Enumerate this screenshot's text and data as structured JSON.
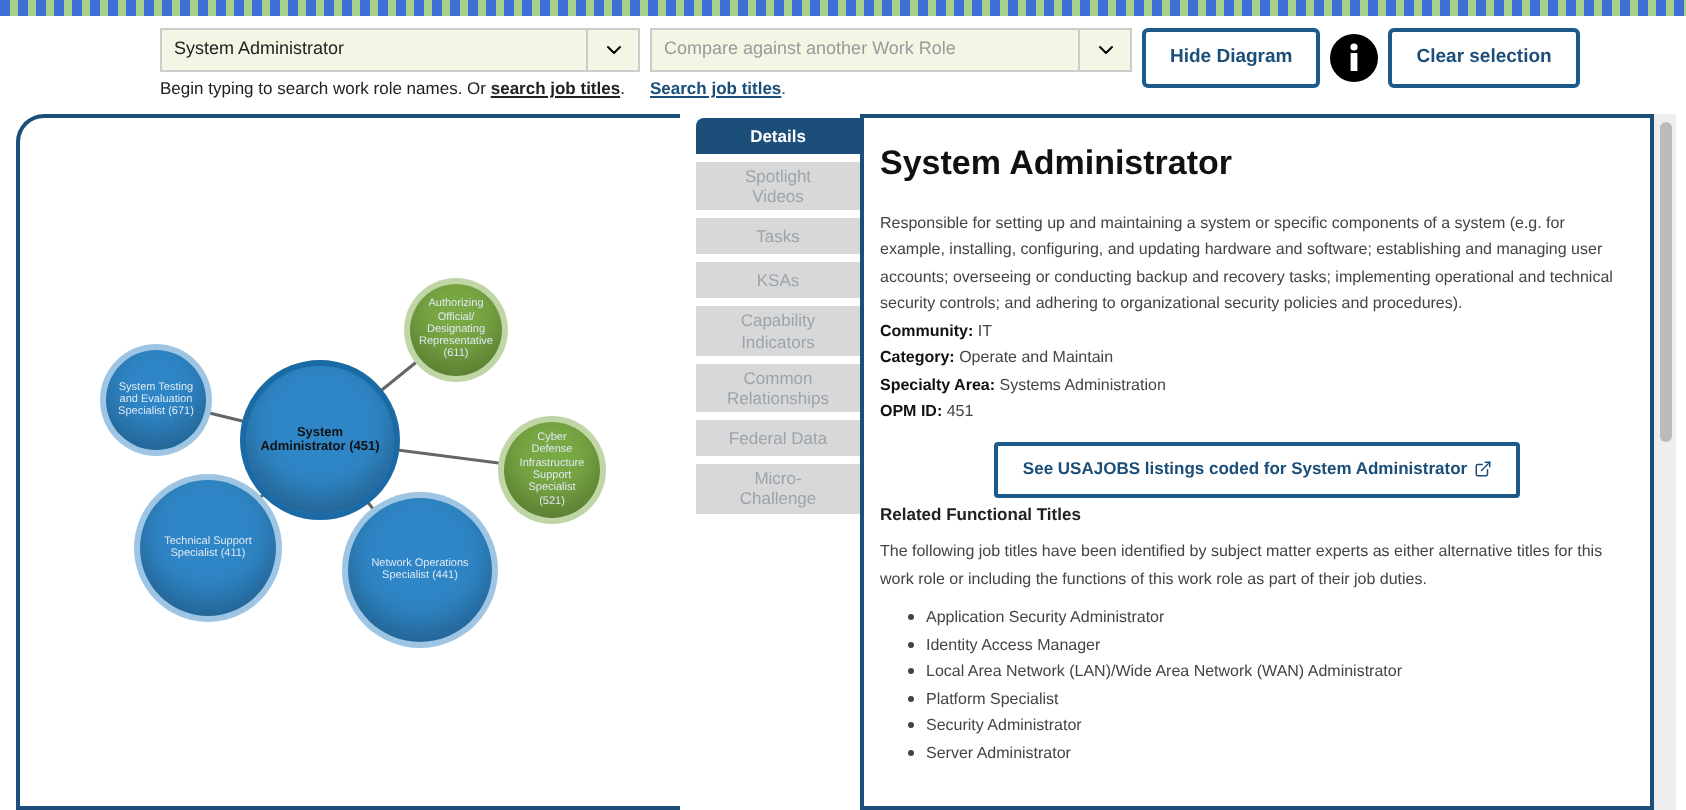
{
  "search": {
    "role_select": {
      "value": "System Administrator"
    },
    "compare_select": {
      "placeholder": "Compare against another Work Role"
    },
    "hint": {
      "text": "Begin typing to search work role names. Or ",
      "link": "search job titles",
      "end": "."
    },
    "compare_hint": {
      "link": "Search job titles",
      "end": "."
    },
    "buttons": [
      {
        "kind": "button",
        "label": "Hide Diagram"
      },
      {
        "kind": "info"
      },
      {
        "kind": "button",
        "label": "Clear selection"
      }
    ]
  },
  "diagram": {
    "nodes": [
      {
        "label": "System Administrator (451)",
        "color": "#2f86c6",
        "selected": true
      },
      {
        "label": "System Testing and Evaluation Specialist (671)",
        "color": "#2f86c6",
        "selected": false
      },
      {
        "label": "Authorizing Official/ Designating Representative (611)",
        "color": "#7aa844",
        "selected": false
      },
      {
        "label": "Cyber Defense Infrastructure Support Specialist (521)",
        "color": "#7aa844",
        "selected": false
      },
      {
        "label": "Technical Support Specialist (411)",
        "color": "#2f86c6",
        "selected": false
      },
      {
        "label": "Network Operations Specialist (441)",
        "color": "#2f86c6",
        "selected": false
      }
    ]
  },
  "tabs": [
    {
      "label": "Details",
      "selected": true
    },
    {
      "label": "Spotlight Videos",
      "selected": false
    },
    {
      "label": "Tasks",
      "selected": false
    },
    {
      "label": "KSAs",
      "selected": false
    },
    {
      "label": "Capability Indicators",
      "selected": false
    },
    {
      "label": "Common Relationships",
      "selected": false
    },
    {
      "label": "Federal Data",
      "selected": false
    },
    {
      "label": "Micro-Challenge",
      "selected": false
    }
  ],
  "details": {
    "title": "System Administrator",
    "description": "Responsible for setting up and maintaining a system or specific components of a system (e.g. for example, installing, configuring, and updating hardware and software; establishing and managing user accounts; overseeing or conducting backup and recovery tasks; implementing operational and technical security controls; and adhering to organizational security policies and procedures).",
    "fields": [
      {
        "label": "Community:",
        "value": "IT"
      },
      {
        "label": "Category:",
        "value": "Operate and Maintain"
      },
      {
        "label": "Specialty Area:",
        "value": "Systems Administration"
      },
      {
        "label": "OPM ID:",
        "value": "451"
      }
    ],
    "usajobs_button": "See USAJOBS listings coded for System Administrator",
    "related_heading": "Related Functional Titles",
    "related_intro": "The following job titles have been identified by subject matter experts as either alternative titles for this work role or including the functions of this work role as part of their job duties.",
    "related_titles": [
      "Application Security Administrator",
      "Identity Access Manager",
      "Local Area Network (LAN)/Wide Area Network (WAN) Administrator",
      "Platform Specialist",
      "Security Administrator",
      "Server Administrator"
    ]
  }
}
